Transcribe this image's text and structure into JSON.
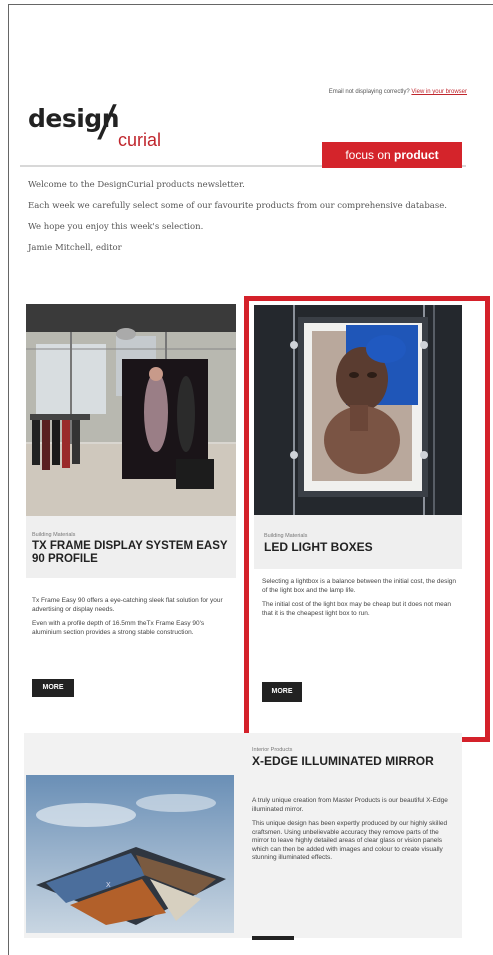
{
  "email_note": {
    "text": "Email not displaying correctly?",
    "link": "View in your browser"
  },
  "logo": {
    "part1": "design",
    "slash": "/",
    "part2": "curial"
  },
  "focus_tab": {
    "prefix": "focus on ",
    "bold": "product"
  },
  "intro": {
    "p1": "Welcome to the DesignCurial products newsletter.",
    "p2": "Each week we carefully select some of our favourite products from our comprehensive database.",
    "p3": "We hope you enjoy this week's selection.",
    "p4": "Jamie Mitchell, editor"
  },
  "products": [
    {
      "category": "Building Materials",
      "title": "TX FRAME DISPLAY SYSTEM EASY 90 PROFILE",
      "para1": "Tx Frame Easy 90 offers a eye-catching sleek flat solution for your advertising or display needs.",
      "para2": "Even with a profile depth of 16.5mm theTx Frame Easy 90's aluminium section provides a strong stable construction.",
      "more": "MORE"
    },
    {
      "category": "Building Materials",
      "title": "LED LIGHT BOXES",
      "para1": "Selecting a lightbox is a balance between the initial cost, the design of the light box and the lamp life.",
      "para2": "The initial cost of the light box may be cheap but it does not mean that it is the cheapest light box to run.",
      "more": "MORE"
    },
    {
      "category": "Interior Products",
      "title": "X-EDGE ILLUMINATED MIRROR",
      "para1": "A truly unique creation from Master Products is our beautiful X-Edge illuminated mirror.",
      "para2": "This unique design has been expertly produced by our highly skilled craftsmen. Using unbelievable accuracy they remove parts of the mirror to leave highly detailed areas of clear glass or vision panels which can then be added with images and colour to create visually stunning illuminated effects."
    }
  ],
  "colors": {
    "accent": "#d4212a",
    "button": "#222222"
  }
}
